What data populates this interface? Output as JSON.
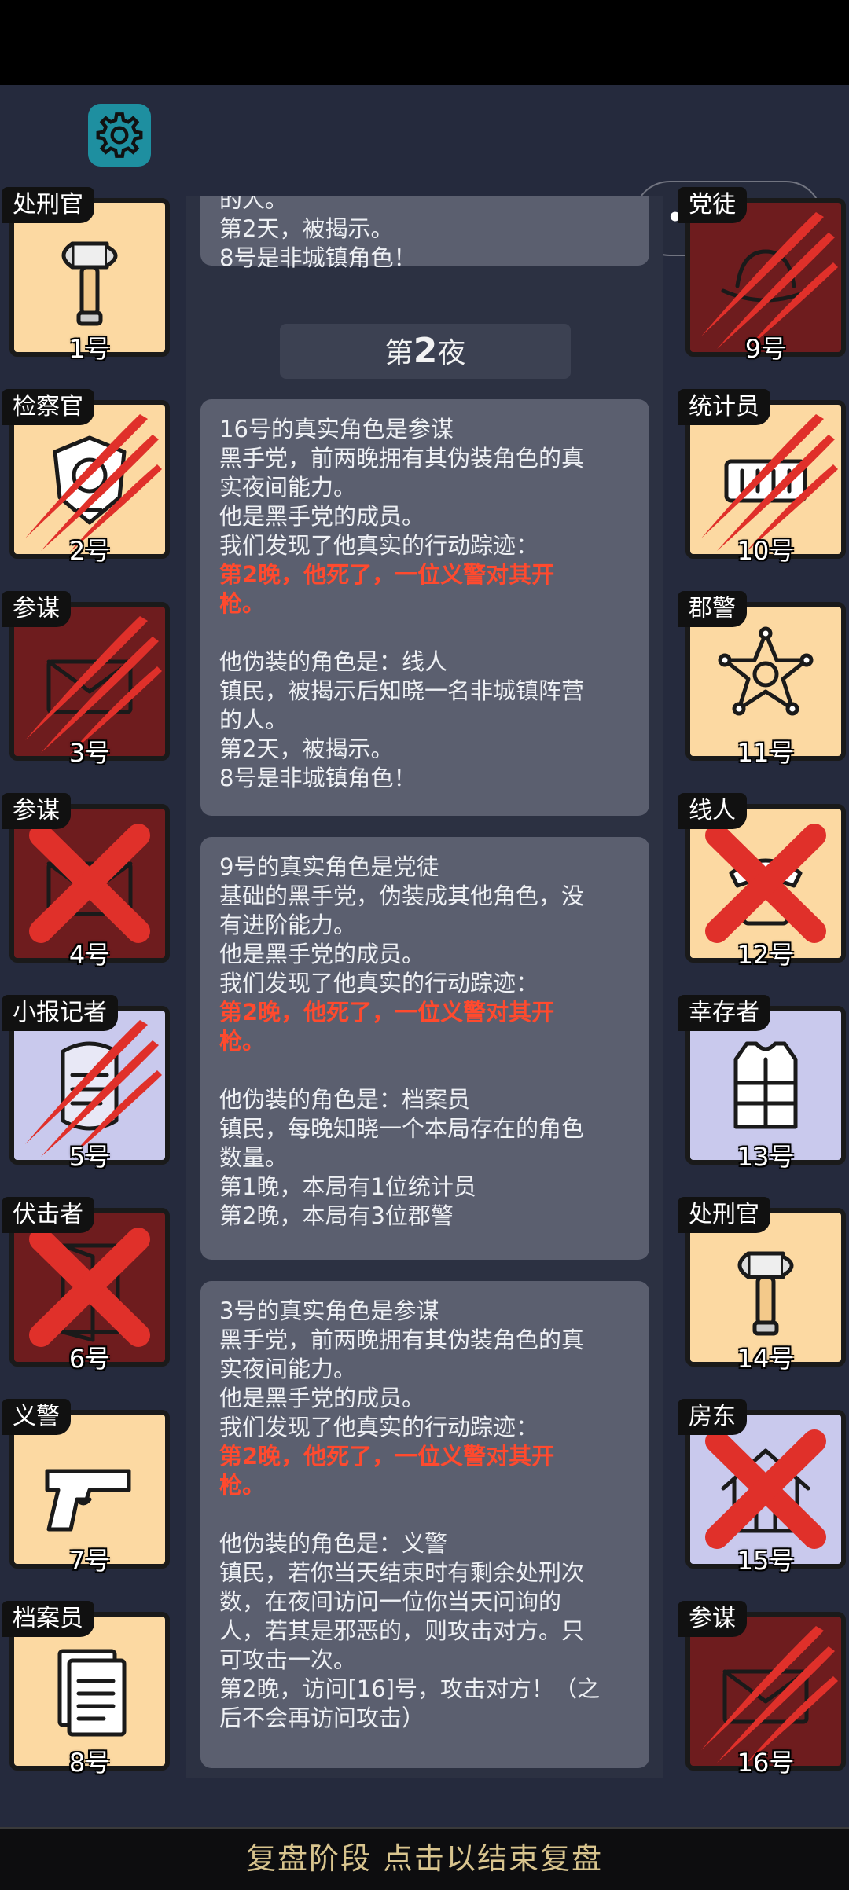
{
  "controls": {
    "capsule_dots": "•••"
  },
  "night_label": {
    "prefix": "第",
    "number": "2",
    "suffix": "夜"
  },
  "cards": [
    {
      "lines": [
        {
          "text": "的人。",
          "type": "normal"
        },
        {
          "text": "第2天，被揭示。",
          "type": "normal"
        },
        {
          "text": "8号是非城镇角色！",
          "type": "normal"
        }
      ]
    },
    {
      "lines": [
        {
          "text": "16号的真实角色是参谋",
          "type": "normal"
        },
        {
          "text": "黑手党，前两晚拥有其伪装角色的真",
          "type": "normal"
        },
        {
          "text": "实夜间能力。",
          "type": "normal"
        },
        {
          "text": "他是黑手党的成员。",
          "type": "normal"
        },
        {
          "text": "我们发现了他真实的行动踪迹：",
          "type": "normal"
        },
        {
          "text": "第2晚，他死了，一位义警对其开",
          "type": "death"
        },
        {
          "text": "枪。",
          "type": "death"
        },
        {
          "text": "",
          "type": "normal"
        },
        {
          "text": "他伪装的角色是：线人",
          "type": "normal"
        },
        {
          "text": "镇民，被揭示后知晓一名非城镇阵营",
          "type": "normal"
        },
        {
          "text": "的人。",
          "type": "normal"
        },
        {
          "text": "第2天，被揭示。",
          "type": "normal"
        },
        {
          "text": "8号是非城镇角色！",
          "type": "normal"
        }
      ]
    },
    {
      "lines": [
        {
          "text": "9号的真实角色是党徒",
          "type": "normal"
        },
        {
          "text": "基础的黑手党，伪装成其他角色，没",
          "type": "normal"
        },
        {
          "text": "有进阶能力。",
          "type": "normal"
        },
        {
          "text": "他是黑手党的成员。",
          "type": "normal"
        },
        {
          "text": "我们发现了他真实的行动踪迹：",
          "type": "normal"
        },
        {
          "text": "第2晚，他死了，一位义警对其开",
          "type": "death"
        },
        {
          "text": "枪。",
          "type": "death"
        },
        {
          "text": "",
          "type": "normal"
        },
        {
          "text": "他伪装的角色是：档案员",
          "type": "normal"
        },
        {
          "text": "镇民，每晚知晓一个本局存在的角色",
          "type": "normal"
        },
        {
          "text": "数量。",
          "type": "normal"
        },
        {
          "text": "第1晚，本局有1位统计员",
          "type": "normal"
        },
        {
          "text": "第2晚，本局有3位郡警",
          "type": "normal"
        }
      ]
    },
    {
      "lines": [
        {
          "text": "3号的真实角色是参谋",
          "type": "normal"
        },
        {
          "text": "黑手党，前两晚拥有其伪装角色的真",
          "type": "normal"
        },
        {
          "text": "实夜间能力。",
          "type": "normal"
        },
        {
          "text": "他是黑手党的成员。",
          "type": "normal"
        },
        {
          "text": "我们发现了他真实的行动踪迹：",
          "type": "normal"
        },
        {
          "text": "第2晚，他死了，一位义警对其开",
          "type": "death"
        },
        {
          "text": "枪。",
          "type": "death"
        },
        {
          "text": "",
          "type": "normal"
        },
        {
          "text": "他伪装的角色是：义警",
          "type": "normal"
        },
        {
          "text": "镇民，若你当天结束时有剩余处刑次",
          "type": "normal"
        },
        {
          "text": "数，在夜间访问一位你当天问询的",
          "type": "normal"
        },
        {
          "text": "人，若其是邪恶的，则攻击对方。只",
          "type": "normal"
        },
        {
          "text": "可攻击一次。",
          "type": "normal"
        },
        {
          "text": "第2晚，访问[16]号，攻击对方！（之",
          "type": "normal"
        },
        {
          "text": "后不会再访问攻击）",
          "type": "normal"
        }
      ]
    }
  ],
  "players": [
    {
      "role": "处刑官",
      "number": "1号",
      "side": "left",
      "bg": "good",
      "icon": "axe-icon",
      "mark": "none"
    },
    {
      "role": "检察官",
      "number": "2号",
      "side": "left",
      "bg": "good",
      "icon": "badge-icon",
      "mark": "claw"
    },
    {
      "role": "参谋",
      "number": "3号",
      "side": "left",
      "bg": "evil",
      "icon": "envelope-icon",
      "mark": "claw"
    },
    {
      "role": "参谋",
      "number": "4号",
      "side": "left",
      "bg": "evil",
      "icon": "envelope-icon",
      "mark": "cross"
    },
    {
      "role": "小报记者",
      "number": "5号",
      "side": "left",
      "bg": "outs",
      "icon": "scroll-icon",
      "mark": "claw"
    },
    {
      "role": "伏击者",
      "number": "6号",
      "side": "left",
      "bg": "evil",
      "icon": "door-icon",
      "mark": "cross"
    },
    {
      "role": "义警",
      "number": "7号",
      "side": "left",
      "bg": "good",
      "icon": "pistol-icon",
      "mark": "none"
    },
    {
      "role": "档案员",
      "number": "8号",
      "side": "left",
      "bg": "good",
      "icon": "documents-icon",
      "mark": "none"
    },
    {
      "role": "党徒",
      "number": "9号",
      "side": "right",
      "bg": "evil",
      "icon": "hat-icon",
      "mark": "claw"
    },
    {
      "role": "统计员",
      "number": "10号",
      "side": "right",
      "bg": "good",
      "icon": "counter-icon",
      "mark": "claw"
    },
    {
      "role": "郡警",
      "number": "11号",
      "side": "right",
      "bg": "good",
      "icon": "star-badge-icon",
      "mark": "none"
    },
    {
      "role": "线人",
      "number": "12号",
      "side": "right",
      "bg": "good",
      "icon": "phone-icon",
      "mark": "cross"
    },
    {
      "role": "幸存者",
      "number": "13号",
      "side": "right",
      "bg": "outs",
      "icon": "vest-icon",
      "mark": "none"
    },
    {
      "role": "处刑官",
      "number": "14号",
      "side": "right",
      "bg": "good",
      "icon": "axe-icon",
      "mark": "none"
    },
    {
      "role": "房东",
      "number": "15号",
      "side": "right",
      "bg": "outs",
      "icon": "house-icon",
      "mark": "cross"
    },
    {
      "role": "参谋",
      "number": "16号",
      "side": "right",
      "bg": "evil",
      "icon": "envelope-icon",
      "mark": "claw"
    }
  ],
  "bottom_bar": {
    "label": "复盘阶段 点击以结束复盘"
  },
  "colors": {
    "death_text": "#ff4a2e",
    "good_bg": "#fcd9a2",
    "evil_bg": "#6e1c1e",
    "outsider_bg": "#c9c9ed",
    "claw": "#e0302a"
  }
}
